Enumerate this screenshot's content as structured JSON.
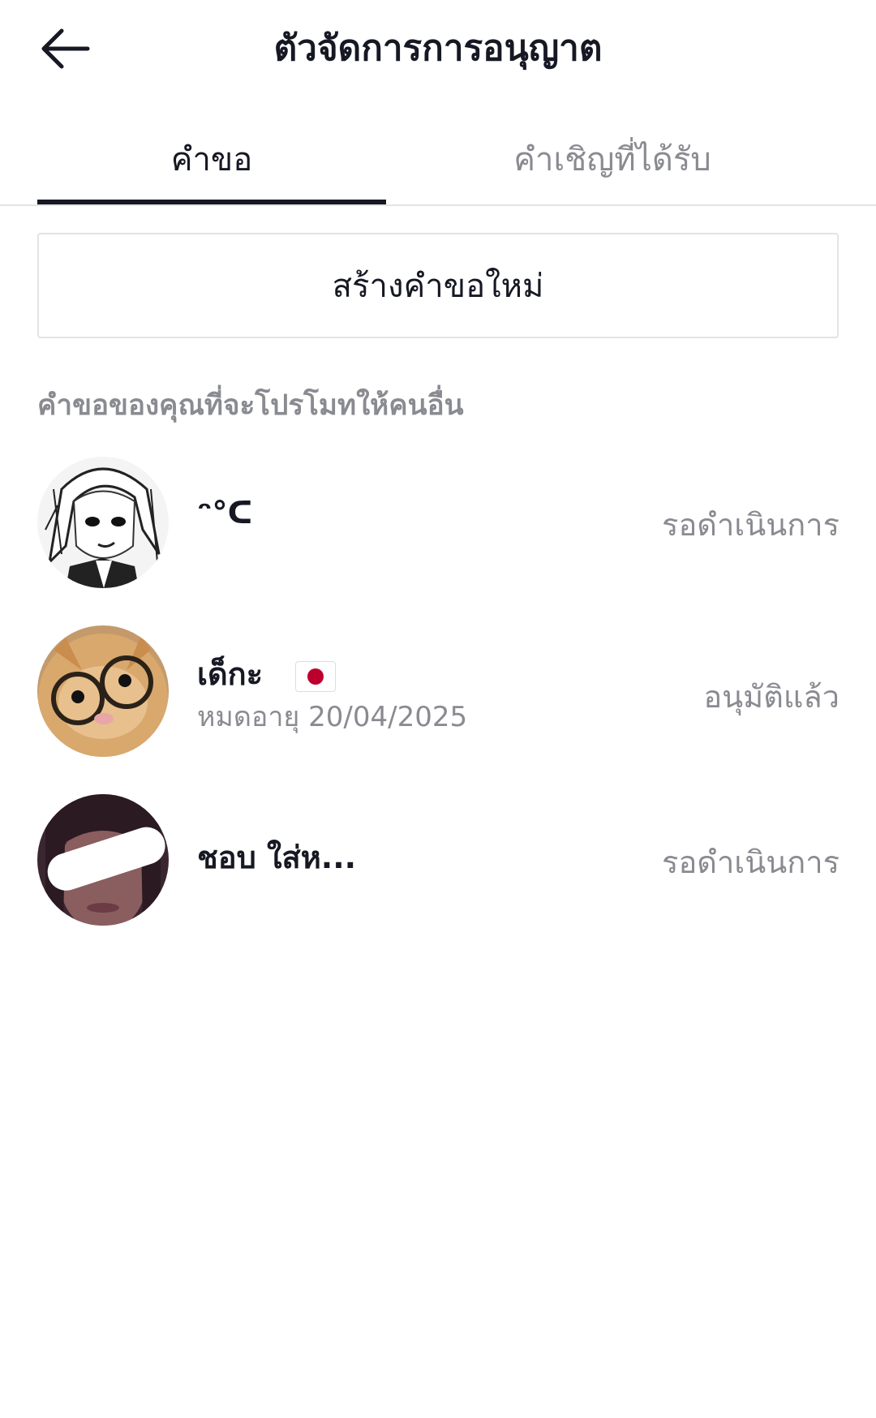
{
  "header": {
    "title": "ตัวจัดการการอนุญาต",
    "back_icon": "arrow-left-icon"
  },
  "tabs": [
    {
      "label": "คำขอ",
      "active": true
    },
    {
      "label": "คำเชิญที่ได้รับ",
      "active": false
    }
  ],
  "create_button": {
    "label": "สร้างคำขอใหม่"
  },
  "section": {
    "label": "คำขอของคุณที่จะโปรโมทให้คนอื่น"
  },
  "requests": [
    {
      "name": "ᵔ°ᑕ",
      "sub": "",
      "status": "รอดำเนินการ",
      "flag": ""
    },
    {
      "name": "เด็กะ",
      "sub": "หมดอายุ 20/04/2025",
      "status": "อนุมัติแล้ว",
      "flag": "japan-flag-icon"
    },
    {
      "name": "ชอบ ใส่ห...",
      "sub": "",
      "status": "รอดำเนินการ",
      "flag": ""
    }
  ],
  "colors": {
    "text_primary": "#161823",
    "text_secondary": "#8a8b91",
    "divider": "#e3e3e4"
  }
}
